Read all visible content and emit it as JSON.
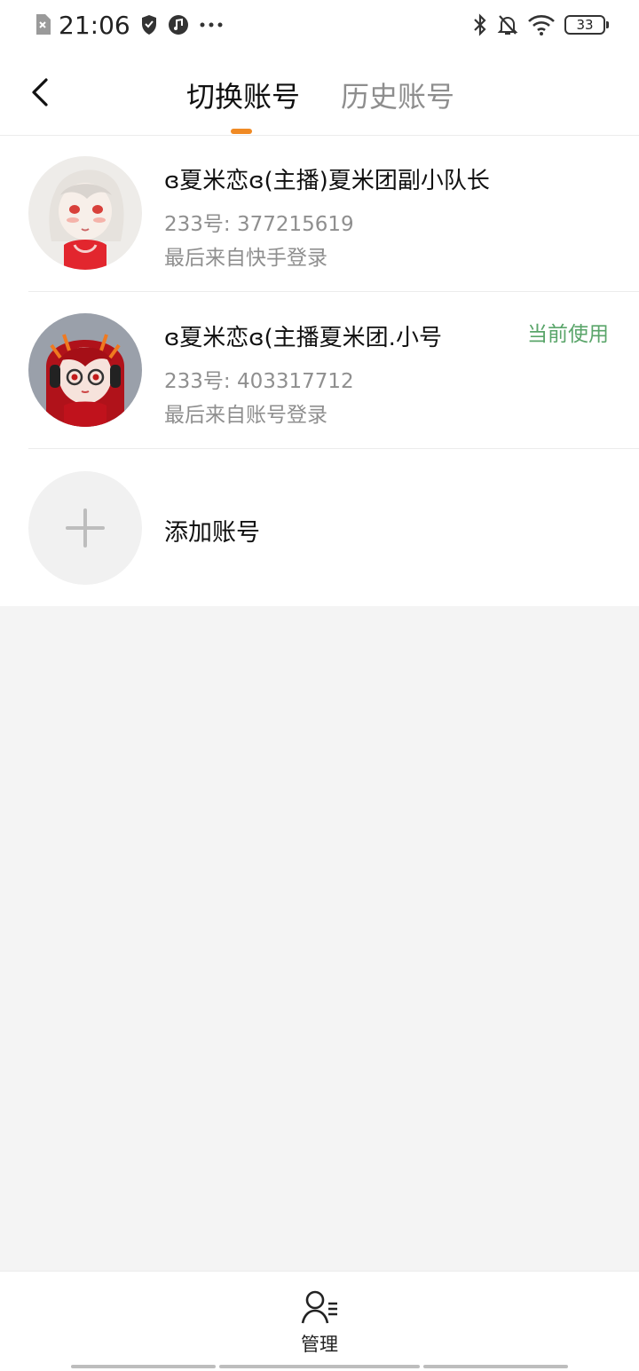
{
  "status_bar": {
    "time": "21:06",
    "battery": "33",
    "icons": [
      "sim-off-icon",
      "shield-icon",
      "music-icon",
      "more-dots-icon",
      "bluetooth-icon",
      "bell-off-icon",
      "wifi-icon",
      "battery-icon"
    ]
  },
  "header": {
    "tabs": [
      {
        "label": "切换账号",
        "active": true
      },
      {
        "label": "历史账号",
        "active": false
      }
    ],
    "indicator_color": "#f08a24"
  },
  "accounts": [
    {
      "name": "ɞ夏米恋ɞ(主播)夏米团副小队长",
      "id_line": "233号: 377215619",
      "source": "最后来自快手登录",
      "current": ""
    },
    {
      "name": "ɞ夏米恋ɞ(主播夏米团.小号",
      "id_line": "233号: 403317712",
      "source": "最后来自账号登录",
      "current": "当前使用"
    }
  ],
  "add_account": {
    "label": "添加账号"
  },
  "bottom": {
    "manage_label": "管理"
  },
  "colors": {
    "accent": "#f08a24",
    "current": "#5aa56a",
    "muted_text": "#8f8f8f",
    "page_bg": "#f4f4f4"
  }
}
